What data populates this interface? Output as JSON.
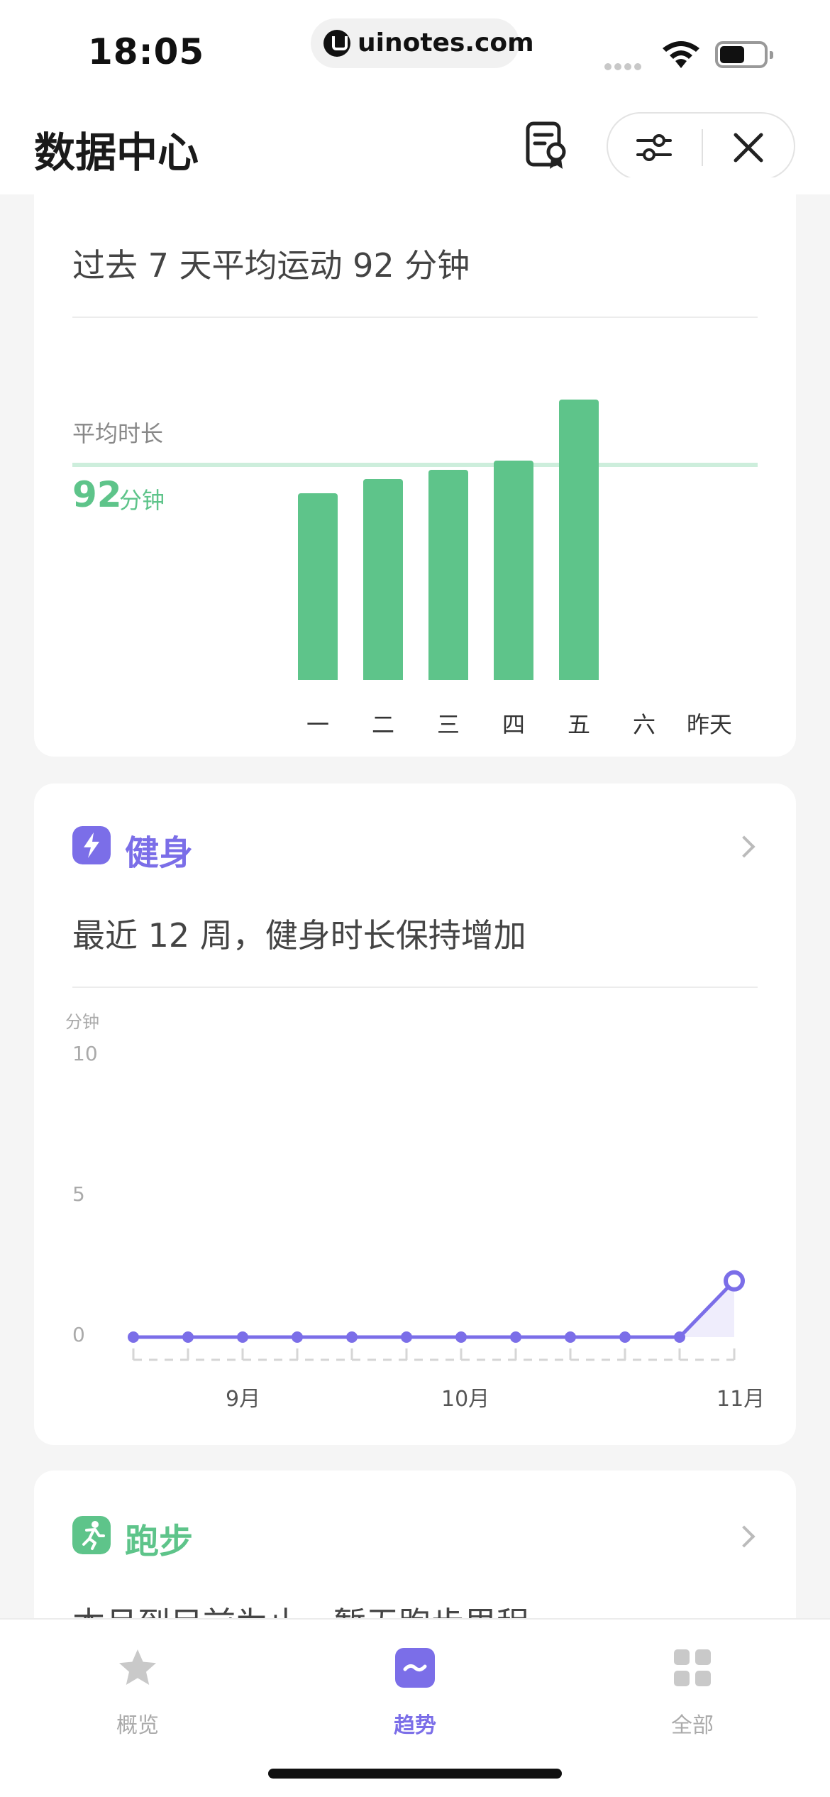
{
  "status_bar": {
    "time": "18:05",
    "url": "uinotes.com",
    "battery_icon": "battery-icon",
    "wifi_icon": "wifi-icon"
  },
  "header": {
    "title": "数据中心",
    "report_icon": "report-badge-icon",
    "filter_icon": "sliders-icon",
    "close_icon": "close-icon"
  },
  "activity_card": {
    "summary": "过去 7 天平均运动 92 分钟",
    "avg_label": "平均时长",
    "avg_value": "92",
    "avg_unit": "分钟",
    "accent_color": "#5ec48a"
  },
  "fitness_card": {
    "title": "健身",
    "summary": "最近 12 周，健身时长保持增加",
    "unit_label": "分钟",
    "y_ticks": [
      "10",
      "5",
      "0"
    ],
    "x_labels": [
      "9月",
      "10月",
      "11月"
    ],
    "accent_color": "#7b6ee8"
  },
  "running_card": {
    "title": "跑步",
    "summary": "本月到目前为止，暂无跑步里程",
    "accent_color": "#5ec48a"
  },
  "tabs": [
    {
      "label": "概览",
      "icon": "star-icon",
      "active": false
    },
    {
      "label": "趋势",
      "icon": "trend-icon",
      "active": true
    },
    {
      "label": "全部",
      "icon": "grid-icon",
      "active": false
    }
  ],
  "chart_data": [
    {
      "type": "bar",
      "categories": [
        "一",
        "二",
        "三",
        "四",
        "五",
        "六",
        "昨天"
      ],
      "values": [
        80,
        86,
        90,
        94,
        120,
        0,
        0
      ],
      "reference_line": 92,
      "ylim": [
        0,
        130
      ]
    },
    {
      "type": "line",
      "x": [
        "w1",
        "w2",
        "w3",
        "w4",
        "w5",
        "w6",
        "w7",
        "w8",
        "w9",
        "w10",
        "w11",
        "w12"
      ],
      "values": [
        0,
        0,
        0,
        0,
        0,
        0,
        0,
        0,
        0,
        0,
        0,
        2
      ],
      "ylim": [
        0,
        10
      ]
    }
  ]
}
